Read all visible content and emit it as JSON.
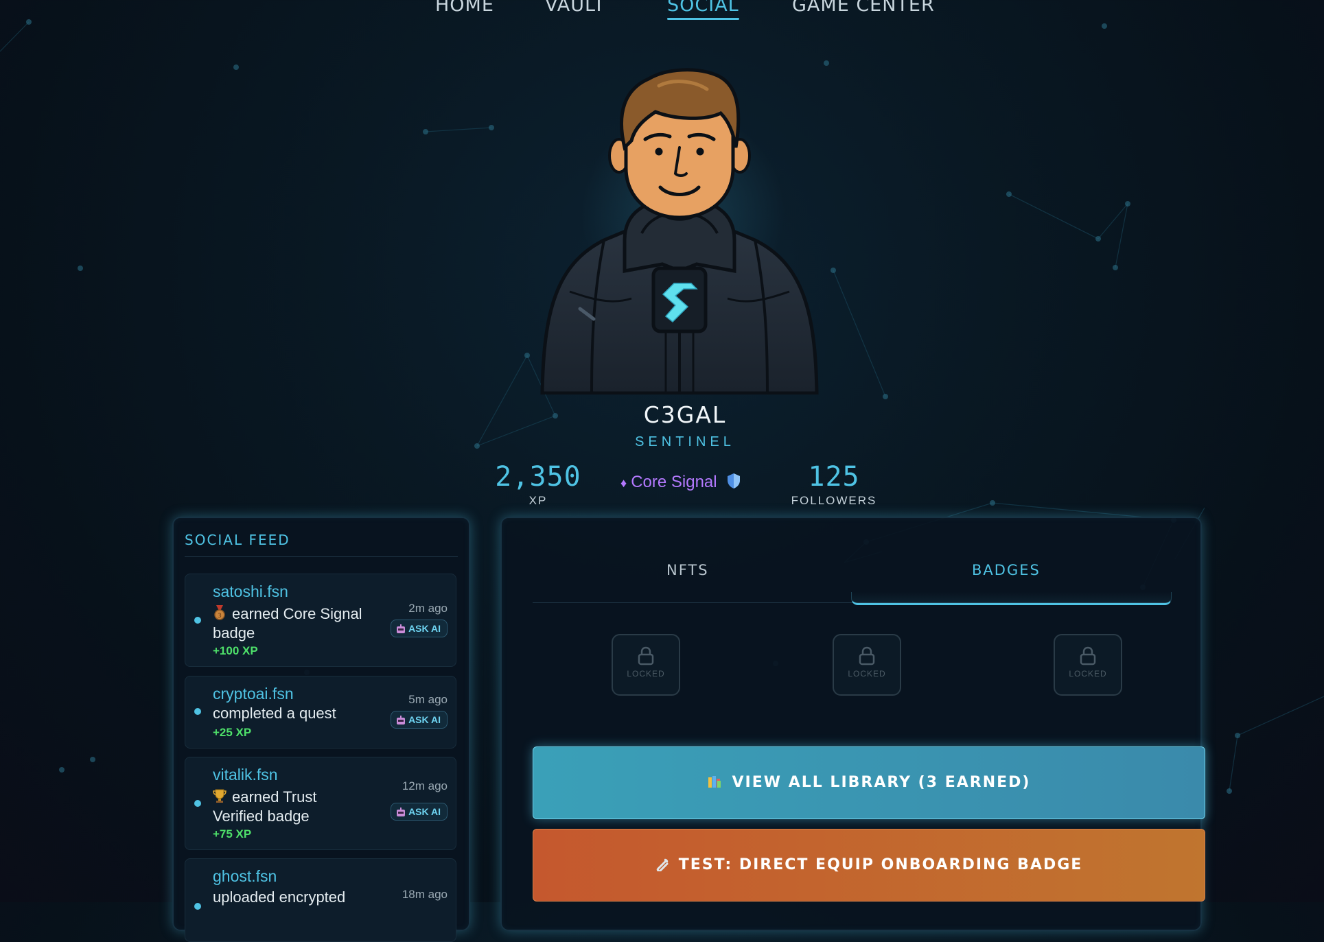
{
  "nav": {
    "items": [
      {
        "label": "HOME"
      },
      {
        "label": "VAULT"
      },
      {
        "label": "SOCIAL"
      },
      {
        "label": "GAME CENTER"
      }
    ],
    "active": "SOCIAL"
  },
  "profile": {
    "name": "C3GAL",
    "rank": "SENTINEL",
    "xp_value": "2,350",
    "xp_label": "XP",
    "tier_label": "Core Signal",
    "followers_value": "125",
    "followers_label": "FOLLOWERS"
  },
  "feed": {
    "title": "SOCIAL FEED",
    "ask_label": "ASK AI",
    "items": [
      {
        "user": "satoshi.fsn",
        "action": "earned Core Signal badge",
        "xp": "+100 XP",
        "time": "2m ago",
        "icon": "bronze-medal-icon"
      },
      {
        "user": "cryptoai.fsn",
        "action": "completed a quest",
        "xp": "+25 XP",
        "time": "5m ago",
        "icon": ""
      },
      {
        "user": "vitalik.fsn",
        "action": "earned Trust Verified badge",
        "xp": "+75 XP",
        "time": "12m ago",
        "icon": "trophy-icon"
      },
      {
        "user": "ghost.fsn",
        "action": "uploaded encrypted",
        "xp": "",
        "time": "18m ago",
        "icon": ""
      }
    ]
  },
  "collection": {
    "tabs": [
      {
        "label": "NFTS"
      },
      {
        "label": "BADGES"
      }
    ],
    "active_tab": "BADGES",
    "slots": [
      {
        "label": "LOCKED"
      },
      {
        "label": "LOCKED"
      },
      {
        "label": "LOCKED"
      }
    ],
    "library_button": "VIEW ALL LIBRARY (3 EARNED)",
    "test_button": "TEST: DIRECT EQUIP ONBOARDING BADGE"
  },
  "colors": {
    "accent": "#4fc3e4",
    "xp_green": "#4ee06a",
    "tier_purple": "#b479ff",
    "library_button": "#3a9ab5",
    "test_button": "#c4612f"
  }
}
